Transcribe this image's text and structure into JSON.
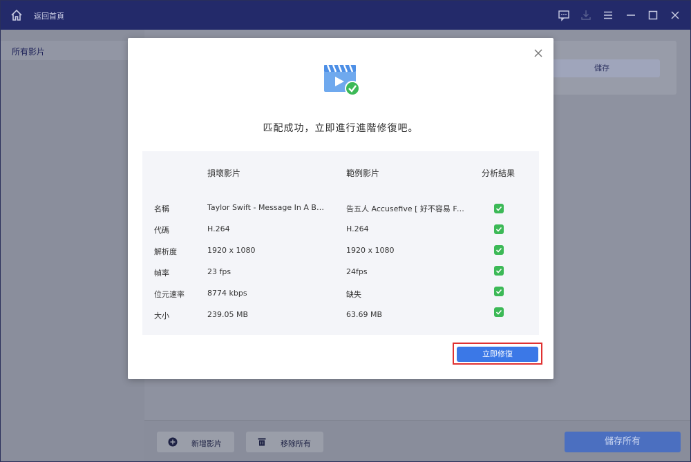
{
  "titlebar": {
    "back_label": "返回首頁"
  },
  "sidebar": {
    "items": [
      {
        "label": "所有影片"
      }
    ]
  },
  "background": {
    "save_label": "儲存"
  },
  "bottombar": {
    "add_label": "新增影片",
    "remove_label": "移除所有",
    "save_all_label": "儲存所有"
  },
  "dialog": {
    "message": "匹配成功，立即進行進階修復吧。",
    "headers": {
      "damaged": "損壞影片",
      "sample": "範例影片",
      "result": "分析結果"
    },
    "rows": [
      {
        "label": "名稱",
        "damaged": "Taylor Swift - Message In A Bottl...",
        "sample": "告五人 Accusefive [ 好不容易 Fin...",
        "ok": true
      },
      {
        "label": "代碼",
        "damaged": "H.264",
        "sample": "H.264",
        "ok": true
      },
      {
        "label": "解析度",
        "damaged": "1920 x 1080",
        "sample": "1920 x 1080",
        "ok": true
      },
      {
        "label": "幀率",
        "damaged": "23 fps",
        "sample": "24fps",
        "ok": true
      },
      {
        "label": "位元速率",
        "damaged": "8774 kbps",
        "sample": "缺失",
        "ok": true
      },
      {
        "label": "大小",
        "damaged": "239.05 MB",
        "sample": "63.69 MB",
        "ok": true
      }
    ],
    "repair_label": "立即修復"
  },
  "colors": {
    "titlebar": "#232a6a",
    "accent": "#3b78e7",
    "check": "#3cb957",
    "highlight": "#e03131"
  }
}
